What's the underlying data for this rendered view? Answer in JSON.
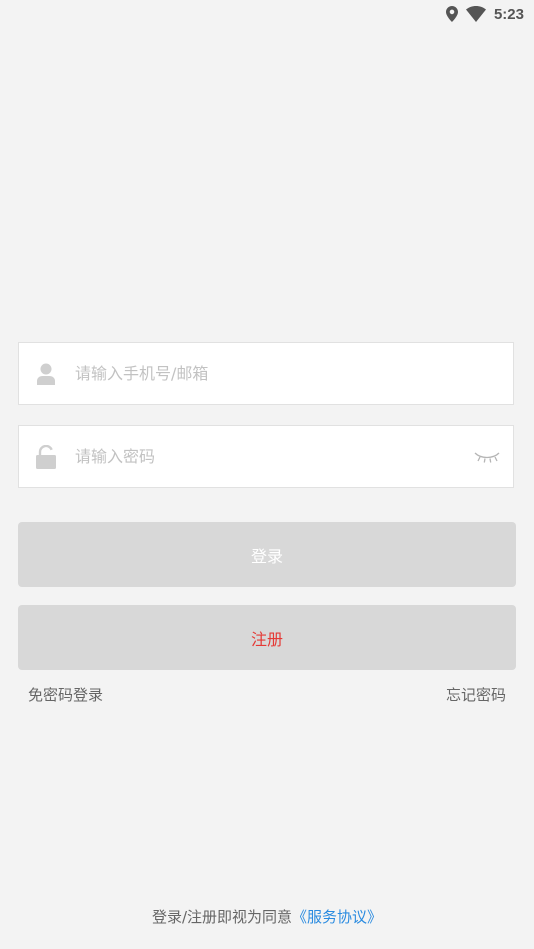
{
  "status_bar": {
    "icons": [
      "location-icon",
      "wifi-icon"
    ],
    "time": "5:23"
  },
  "login_form": {
    "account_placeholder": "请输入手机号/邮箱",
    "account_value": "",
    "password_placeholder": "请输入密码",
    "password_value": "",
    "login_button": "登录",
    "register_button": "注册",
    "passwordless_login": "免密码登录",
    "forgot_password": "忘记密码"
  },
  "footer": {
    "notice": "登录/注册即视为同意",
    "agreement_link": "《服务协议》"
  },
  "colors": {
    "background": "#f3f3f3",
    "button_bg": "#d8d8d8",
    "register_text": "#e53935",
    "link_blue": "#2a8be0"
  }
}
